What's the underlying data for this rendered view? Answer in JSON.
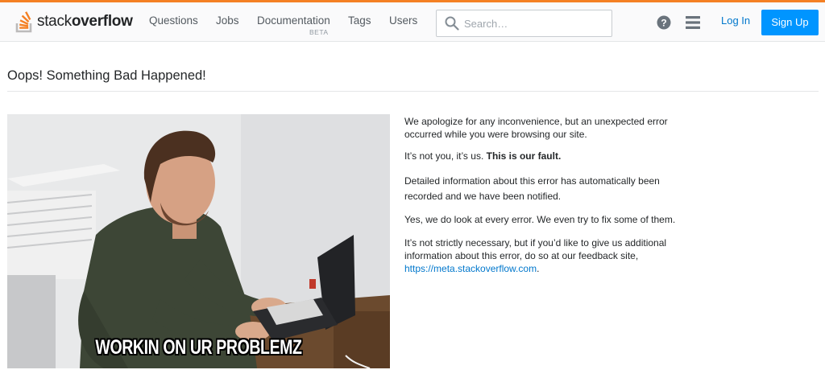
{
  "header": {
    "logo": {
      "text_light": "stack",
      "text_bold": "overflow",
      "icon": "stackoverflow-logo-icon"
    },
    "nav": [
      {
        "label": "Questions",
        "name": "nav-questions"
      },
      {
        "label": "Jobs",
        "name": "nav-jobs"
      },
      {
        "label": "Documentation",
        "name": "nav-documentation"
      },
      {
        "label": "Tags",
        "name": "nav-tags"
      },
      {
        "label": "Users",
        "name": "nav-users"
      }
    ],
    "documentation_badge": "BETA",
    "search": {
      "placeholder": "Search…",
      "value": "",
      "icon": "search-icon"
    },
    "help_icon": "help-icon",
    "menu_icon": "hamburger-menu-icon",
    "login_label": "Log In",
    "signup_label": "Sign Up"
  },
  "page": {
    "title": "Oops! Something Bad Happened!",
    "image_caption": "WORKIN ON UR PROBLEMZ",
    "messages": {
      "apology": "We apologize for any inconvenience, but an unexpected error occurred while you were browsing our site.",
      "not_you": "It’s not you, it’s us.",
      "fault": "This is our fault.",
      "recorded": "Detailed information about this error has automatically been recorded and we have been notified.",
      "look": "Yes, we do look at every error. We even try to fix some of them.",
      "feedback": "It’s not strictly necessary, but if you’d like to give us additional information about this error, do so at our feedback site,",
      "feedback_link": "https://meta.stackoverflow.com",
      "feedback_end": "."
    }
  },
  "colors": {
    "accent_orange": "#f48024",
    "link_blue": "#0077cc",
    "button_blue": "#0095ff"
  }
}
